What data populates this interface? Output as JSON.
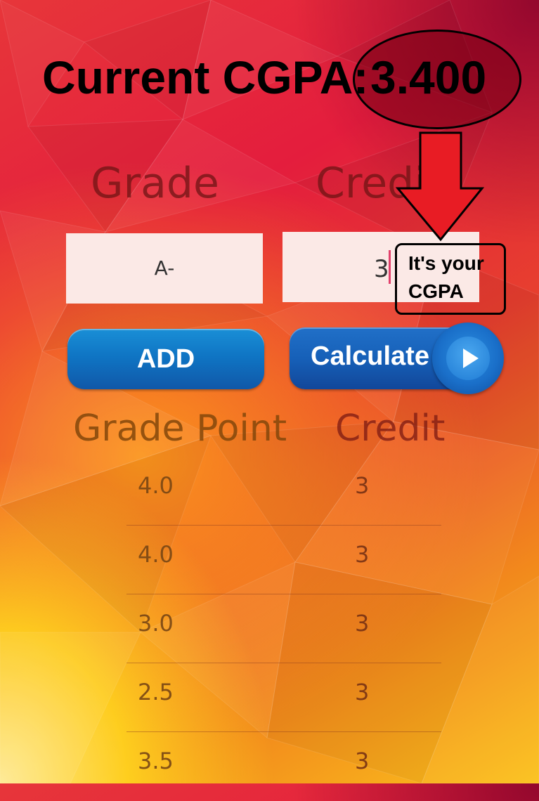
{
  "header": {
    "cgpa_label": "Current CGPA:",
    "cgpa_value": "3.400"
  },
  "inputs": {
    "grade_label": "Grade",
    "credit_label": "Credit",
    "grade_value": "A-",
    "credit_value": "3"
  },
  "buttons": {
    "add_label": "ADD",
    "calculate_label": "Calculate"
  },
  "table": {
    "headers": {
      "grade_point": "Grade Point",
      "credit": "Credit"
    },
    "rows": [
      {
        "grade_point": "4.0",
        "credit": "3"
      },
      {
        "grade_point": "4.0",
        "credit": "3"
      },
      {
        "grade_point": "3.0",
        "credit": "3"
      },
      {
        "grade_point": "2.5",
        "credit": "3"
      },
      {
        "grade_point": "3.5",
        "credit": "3"
      }
    ]
  },
  "annotation": {
    "note": "It's your CGPA",
    "arrow_icon": "red-down-arrow",
    "arrow_color": "#e81c24"
  },
  "colors": {
    "button_blue": "#1a6fc9",
    "field_background": "#fbe9e6",
    "caret": "#e2406b"
  }
}
